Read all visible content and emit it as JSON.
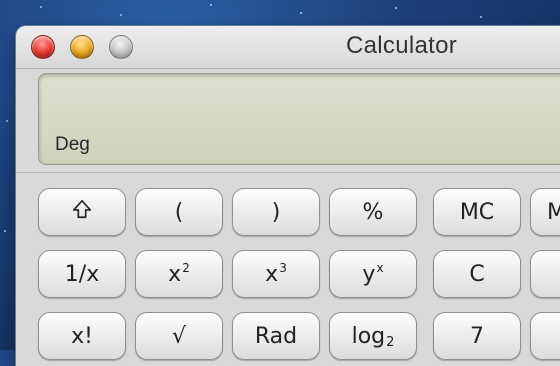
{
  "window": {
    "title": "Calculator"
  },
  "display": {
    "mode": "Deg"
  },
  "keys": {
    "row1": [
      "(",
      ")",
      "%",
      "MC",
      "M"
    ],
    "row2": [
      "1/x",
      "C"
    ],
    "row3": [
      "x!",
      "Rad",
      "7"
    ],
    "x2": {
      "base": "x",
      "exp": "2"
    },
    "x3": {
      "base": "x",
      "exp": "3"
    },
    "yx": {
      "base": "y",
      "exp": "x"
    },
    "log2": {
      "base": "log",
      "sub": "2"
    },
    "sqrt": "√"
  },
  "icons": {
    "shift": "shift-arrow-icon"
  }
}
